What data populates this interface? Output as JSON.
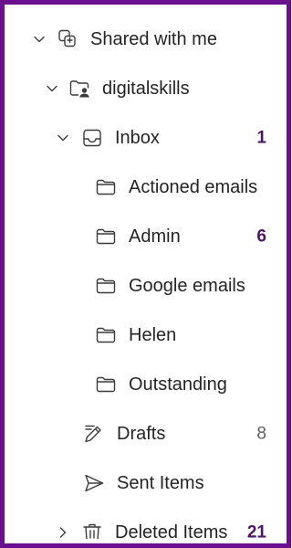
{
  "tree": {
    "shared": {
      "label": "Shared with me",
      "icon": "shared-people-icon",
      "expanded": true
    },
    "account": {
      "label": "digitalskills",
      "icon": "shared-folder-icon",
      "expanded": true
    },
    "inbox": {
      "label": "Inbox",
      "icon": "inbox-icon",
      "count": "1",
      "expanded": true
    },
    "subfolders": [
      {
        "label": "Actioned emails",
        "icon": "folder-icon"
      },
      {
        "label": "Admin",
        "icon": "folder-icon",
        "count": "6"
      },
      {
        "label": "Google emails",
        "icon": "folder-icon"
      },
      {
        "label": "Helen",
        "icon": "folder-icon"
      },
      {
        "label": "Outstanding",
        "icon": "folder-icon"
      }
    ],
    "drafts": {
      "label": "Drafts",
      "icon": "drafts-pencil-icon",
      "count": "8"
    },
    "sent": {
      "label": "Sent Items",
      "icon": "send-icon"
    },
    "deleted": {
      "label": "Deleted Items",
      "icon": "trash-icon",
      "count": "21",
      "expanded": false
    }
  },
  "colors": {
    "frame_border": "#6a0f8e",
    "unread_count": "#4b1666",
    "text": "#242424",
    "muted_count": "#616161"
  }
}
